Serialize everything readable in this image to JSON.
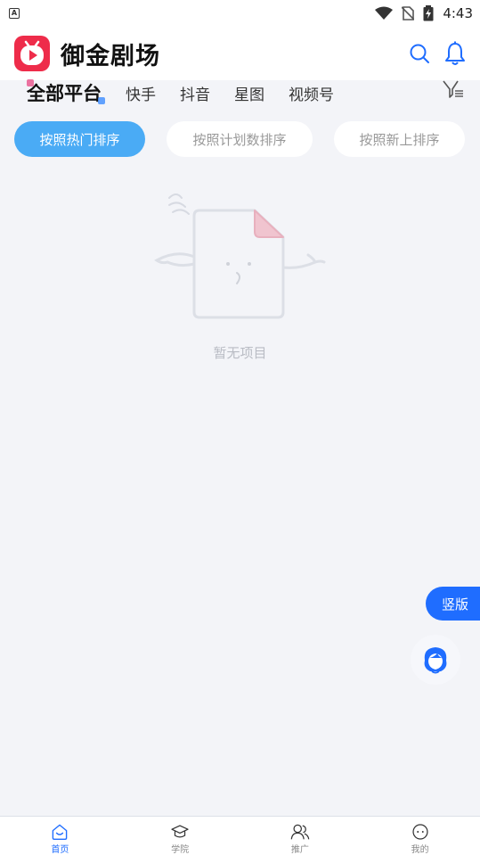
{
  "status_bar": {
    "time": "4:43",
    "left_badge": "A"
  },
  "header": {
    "title": "御金剧场"
  },
  "platform_tabs": [
    {
      "label": "全部平台",
      "active": true
    },
    {
      "label": "快手",
      "active": false
    },
    {
      "label": "抖音",
      "active": false
    },
    {
      "label": "星图",
      "active": false
    },
    {
      "label": "视频号",
      "active": false
    }
  ],
  "sort_buttons": [
    {
      "label": "按照热门排序",
      "active": true
    },
    {
      "label": "按照计划数排序",
      "active": false
    },
    {
      "label": "按照新上排序",
      "active": false
    }
  ],
  "empty_state": {
    "text": "暂无项目"
  },
  "floating": {
    "vertical_label": "竖版"
  },
  "bottom_nav": [
    {
      "icon": "home-icon",
      "label": "首页",
      "active": true
    },
    {
      "icon": "school-icon",
      "label": "学院",
      "active": false
    },
    {
      "icon": "people-icon",
      "label": "推广",
      "active": false
    },
    {
      "icon": "profile-icon",
      "label": "我的",
      "active": false
    }
  ],
  "colors": {
    "accent": "#1f6dff",
    "sort_active": "#4aabf5",
    "logo": "#ee2c4a",
    "background": "#f3f4f8"
  }
}
